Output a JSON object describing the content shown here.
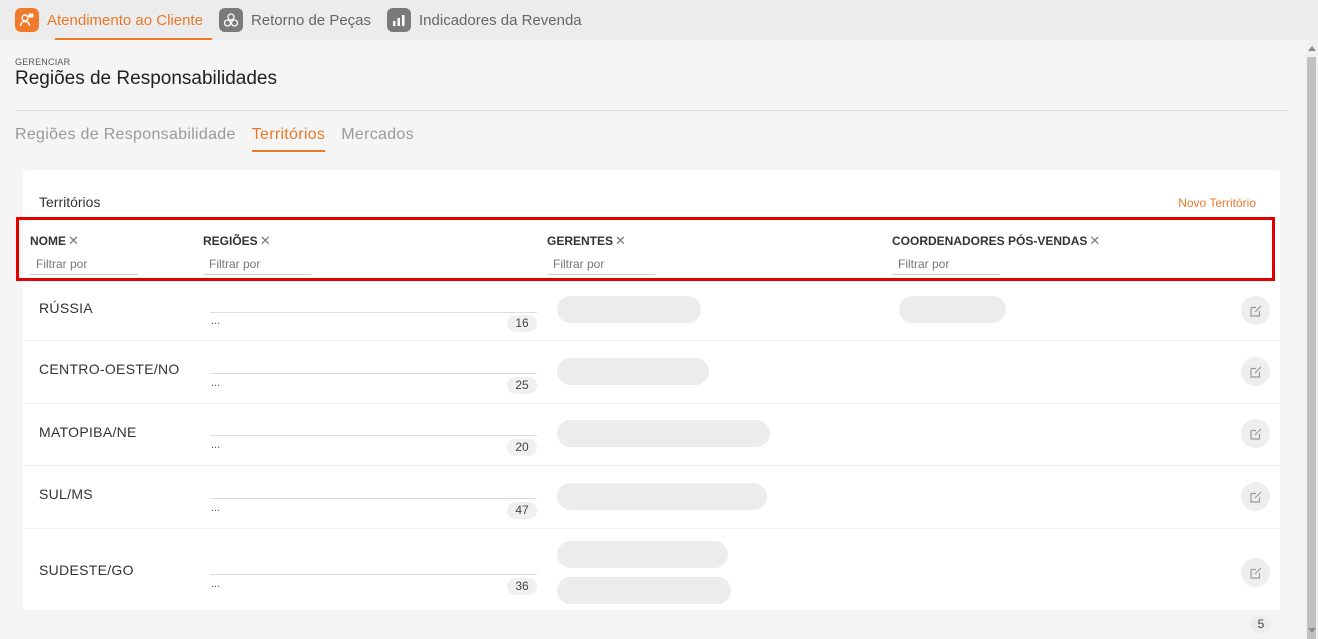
{
  "topnav": [
    {
      "label": "Atendimento ao Cliente",
      "icon": "customer-service-icon",
      "active": true
    },
    {
      "label": "Retorno de Peças",
      "icon": "parts-return-icon",
      "active": false
    },
    {
      "label": "Indicadores da Revenda",
      "icon": "bar-chart-icon",
      "active": false
    }
  ],
  "header": {
    "overline": "GERENCIAR",
    "title": "Regiões de Responsabilidades"
  },
  "tabs": [
    {
      "label": "Regiões de Responsabilidade",
      "active": false
    },
    {
      "label": "Territórios",
      "active": true
    },
    {
      "label": "Mercados",
      "active": false
    }
  ],
  "card": {
    "title": "Territórios",
    "new_button": "Novo Território",
    "columns": [
      {
        "label": "NOME",
        "placeholder": "Filtrar por"
      },
      {
        "label": "REGIÕES",
        "placeholder": "Filtrar por"
      },
      {
        "label": "GERENTES",
        "placeholder": "Filtrar por"
      },
      {
        "label": "COORDENADORES PÓS-VENDAS",
        "placeholder": "Filtrar por"
      }
    ],
    "rows": [
      {
        "name": "RÚSSIA",
        "regions_more": "...",
        "regions_count": "16"
      },
      {
        "name": "CENTRO-OESTE/NO",
        "regions_more": "...",
        "regions_count": "25"
      },
      {
        "name": "MATOPIBA/NE",
        "regions_more": "...",
        "regions_count": "20"
      },
      {
        "name": "SUL/MS",
        "regions_more": "...",
        "regions_count": "47"
      },
      {
        "name": "SUDESTE/GO",
        "regions_more": "...",
        "regions_count": "36"
      }
    ],
    "total_count": "5"
  },
  "colors": {
    "accent": "#f07a2b",
    "highlight_box": "#e00000"
  }
}
